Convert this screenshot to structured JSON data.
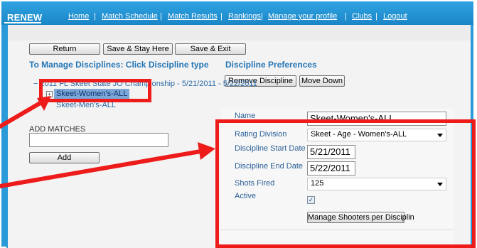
{
  "app": {
    "brand": "RENEW"
  },
  "nav": {
    "items": [
      "Home",
      "Match Schedule",
      "Match Results",
      "Rankings",
      "Manage your profile",
      "Clubs",
      "Logout"
    ],
    "separator": "|"
  },
  "toolbar": {
    "return_label": "Return",
    "save_stay_label": "Save & Stay Here",
    "save_exit_label": "Save & Exit"
  },
  "left": {
    "heading": "To Manage Disciplines: Click Discipline type",
    "tree": {
      "root_prefix": "−",
      "root_label": "2011 FL Skeet State JO Championship - 5/21/2011 - 5/22/2011",
      "child1": "Skeet-Women's-ALL",
      "child2": "Skeet-Men's-ALL",
      "expander_symbol": "+"
    },
    "add_matches_label": "ADD MATCHES",
    "add_matches_value": "",
    "add_button": "Add"
  },
  "prefs": {
    "heading": "Discipline Preferences",
    "remove_button": "Remove Discipline",
    "move_down_button": "Move Down"
  },
  "form": {
    "name_label": "Name",
    "name_value": "Skeet-Women's-ALL",
    "rating_label": "Rating Division",
    "rating_value": "Skeet - Age - Women's-ALL",
    "start_label": "Discipline Start Date",
    "start_value": "5/21/2011",
    "end_label": "Discipline End Date",
    "end_value": "5/22/2011",
    "shots_label": "Shots Fired",
    "shots_value": "125",
    "active_label": "Active",
    "active_checked": true,
    "check_mark": "✓",
    "manage_shooters_button": "Manage Shooters per Disciplin"
  },
  "colors": {
    "header_blue": "#2a9ad8",
    "heading_blue": "#2576b6",
    "annotation_red": "#ee1b1b",
    "selection_blue": "#7aa7d8"
  }
}
